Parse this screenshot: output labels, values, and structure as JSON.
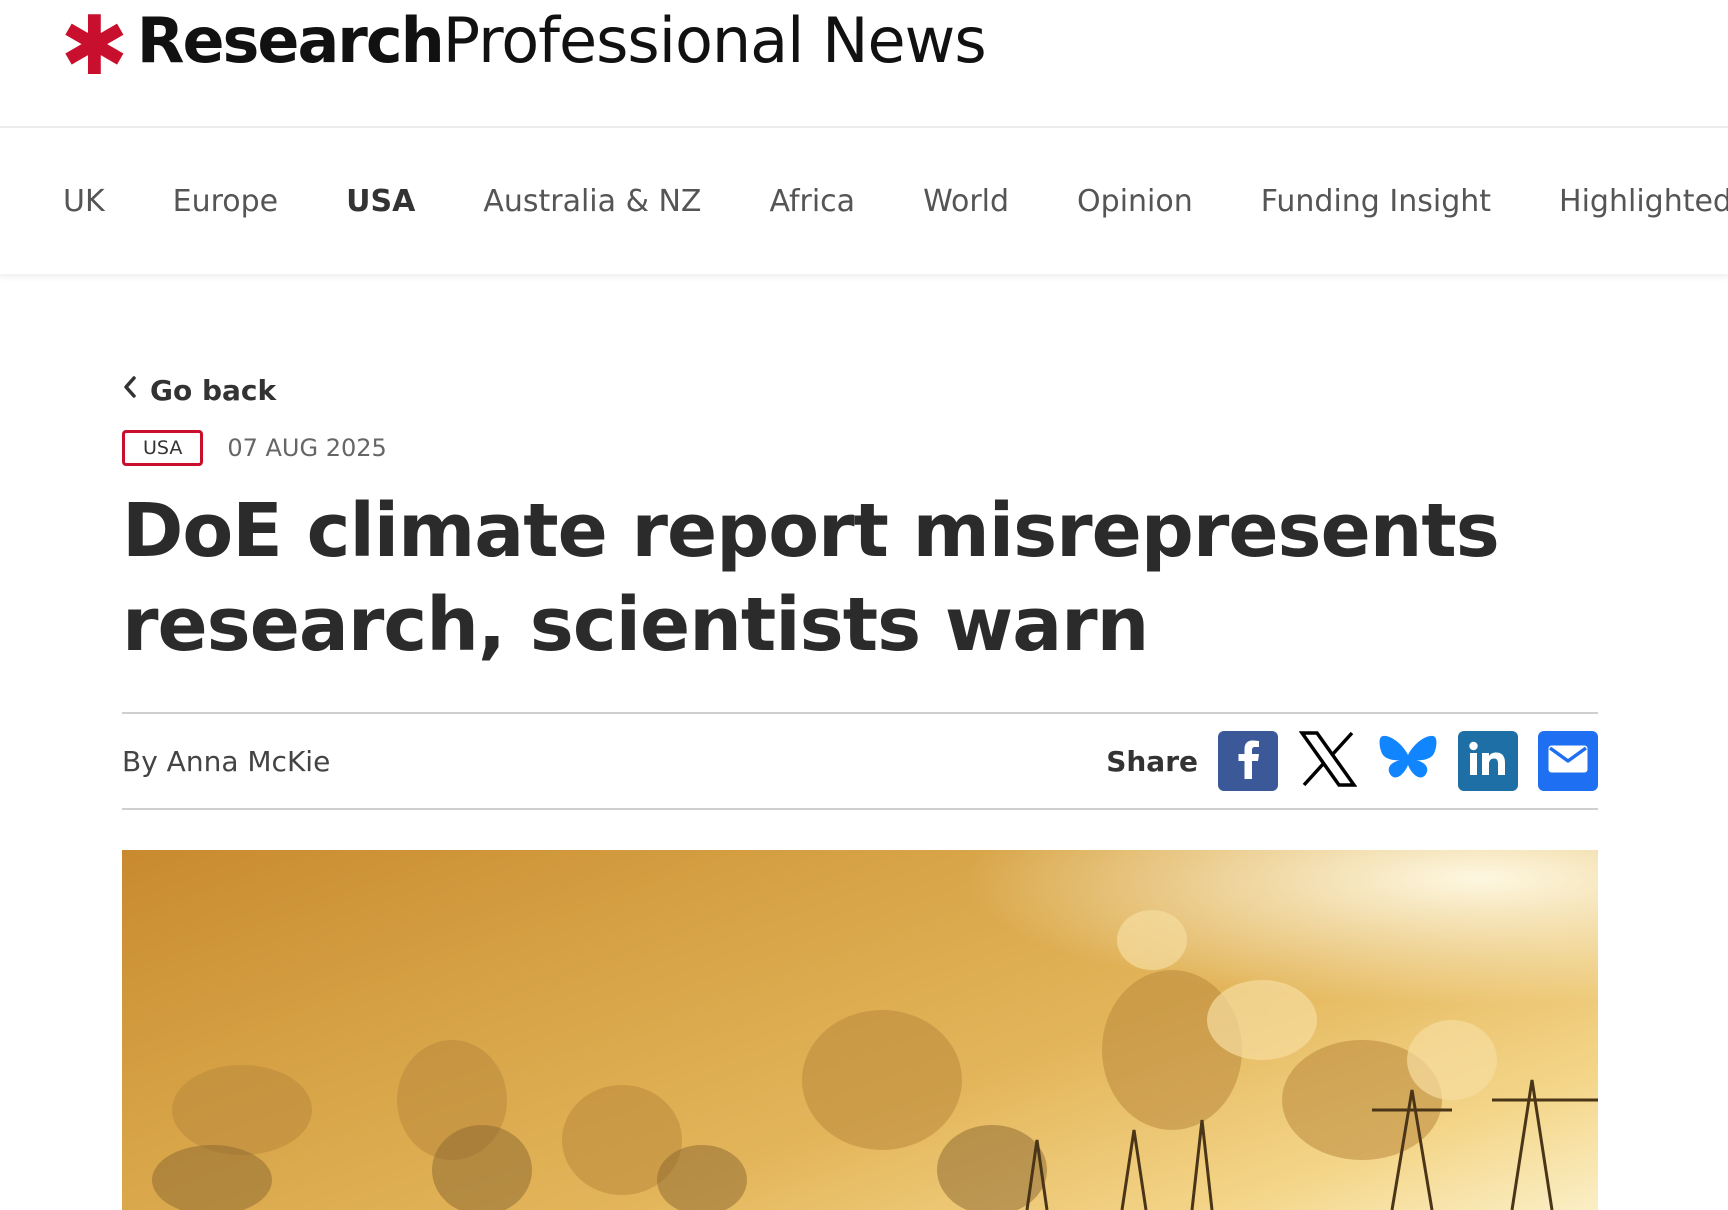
{
  "site": {
    "logo_star": "✱",
    "logo_bold": "Research",
    "logo_light": "Professional News"
  },
  "nav": {
    "items": [
      {
        "label": "UK",
        "active": false
      },
      {
        "label": "Europe",
        "active": false
      },
      {
        "label": "USA",
        "active": true
      },
      {
        "label": "Australia & NZ",
        "active": false
      },
      {
        "label": "Africa",
        "active": false
      },
      {
        "label": "World",
        "active": false
      },
      {
        "label": "Opinion",
        "active": false
      },
      {
        "label": "Funding Insight",
        "active": false
      },
      {
        "label": "Highlighted Func",
        "active": false
      }
    ]
  },
  "article": {
    "go_back": "Go back",
    "region_badge": "USA",
    "date": "07 AUG 2025",
    "headline": "DoE climate report misrepresents research, scientists warn",
    "byline": "By Anna McKie",
    "share_label": "Share"
  },
  "share_buttons": [
    {
      "icon": "facebook-icon",
      "color": "#3b5998"
    },
    {
      "icon": "x-icon",
      "color": "#000000"
    },
    {
      "icon": "bluesky-icon",
      "color": "#1185fe"
    },
    {
      "icon": "linkedin-icon",
      "color": "#1d6fa5"
    },
    {
      "icon": "email-icon",
      "color": "#1f6ff2"
    }
  ],
  "colors": {
    "brand_red": "#c8102e",
    "text_dark": "#2b2b2b"
  }
}
